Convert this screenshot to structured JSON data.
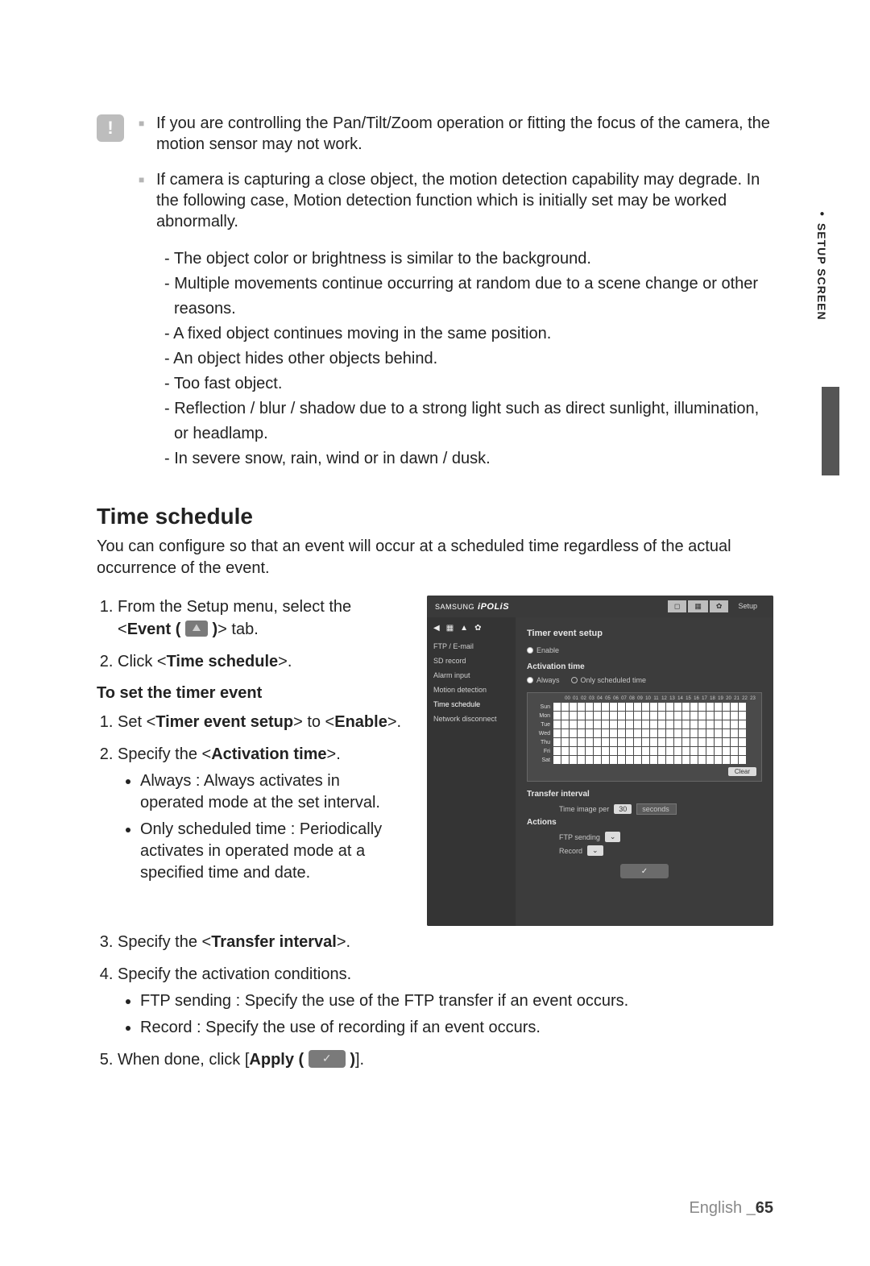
{
  "sideTab": {
    "text": "SETUP SCREEN",
    "bullet": "●"
  },
  "note": {
    "items": [
      "If you are controlling the Pan/Tilt/Zoom operation or fitting the focus of the camera, the motion sensor may not work.",
      "If camera is capturing a close object, the motion detection capability may degrade. In the following case, Motion detection function which is initially set may be worked abnormally."
    ],
    "sub": [
      "The object color or brightness is similar to the background.",
      "Multiple movements continue occurring at random due to a scene change or other reasons.",
      "A fixed object continues moving in the same position.",
      "An object hides other objects behind.",
      "Too fast object.",
      "Reflection / blur / shadow due to a strong light such as direct sunlight, illumination, or headlamp.",
      "In severe snow, rain, wind or in dawn / dusk."
    ]
  },
  "section": {
    "title": "Time schedule",
    "intro": "You can configure so that an event will occur at a scheduled time regardless of the actual occurrence of the event."
  },
  "steps1": {
    "s1a": "From the Setup menu, select the <",
    "s1b": "Event (",
    "s1c": ")",
    "s1d": "> tab.",
    "s2a": "Click <",
    "s2b": "Time schedule",
    "s2c": ">."
  },
  "timerHeading": "To set the timer event",
  "steps2": {
    "s1a": "Set <",
    "s1b": "Timer event setup",
    "s1c": "> to <",
    "s1d": "Enable",
    "s1e": ">.",
    "s2a": "Specify the <",
    "s2b": "Activation time",
    "s2c": ">.",
    "b1": "Always : Always activates in operated mode at the set interval.",
    "b2": "Only scheduled time : Periodically activates in operated mode at a specified time and date.",
    "s3a": "Specify the <",
    "s3b": "Transfer interval",
    "s3c": ">.",
    "s4": "Specify the activation conditions.",
    "b3": "FTP sending : Specify the use of the FTP transfer if an event occurs.",
    "b4": "Record : Specify the use of recording if an event occurs.",
    "s5a": "When done, click [",
    "s5b": "Apply (",
    "s5c": ")",
    "s5d": "]."
  },
  "shot": {
    "logoBrand": "SAMSUNG",
    "logoModel": "iPOLiS",
    "setup": "Setup",
    "sidebar": [
      "FTP / E-mail",
      "SD record",
      "Alarm input",
      "Motion detection",
      "Time schedule",
      "Network disconnect"
    ],
    "h1": "Timer event setup",
    "enable": "Enable",
    "secAct": "Activation time",
    "radioAlways": "Always",
    "radioSched": "Only scheduled time",
    "days": [
      "Sun",
      "Mon",
      "Tue",
      "Wed",
      "Thu",
      "Fri",
      "Sat"
    ],
    "clear": "Clear",
    "secTransfer": "Transfer interval",
    "tLabel": "Time image per",
    "tVal": "30",
    "tUnit": "seconds",
    "secActions": "Actions",
    "ftpLabel": "FTP sending",
    "recLabel": "Record",
    "apply": "✓"
  },
  "footer": {
    "lang": "English ",
    "bold": "_65"
  }
}
